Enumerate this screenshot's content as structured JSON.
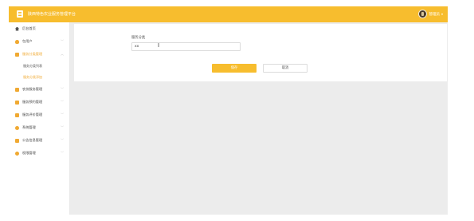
{
  "header": {
    "title": "陕西特色农业服务管理平台",
    "user_name": "管理员",
    "caret": "▾"
  },
  "sidebar": {
    "items": [
      {
        "label": "后台首页",
        "icon": "home-icon"
      },
      {
        "label": "包用户",
        "icon": "user-icon"
      },
      {
        "label": "服务分类管理",
        "icon": "grid-icon",
        "open": true,
        "children": [
          {
            "label": "服务分类列表",
            "active": false
          },
          {
            "label": "服务分类添加",
            "active": true
          }
        ]
      },
      {
        "label": "农技服务管理",
        "icon": "grid-icon"
      },
      {
        "label": "服务预约管理",
        "icon": "grid-icon"
      },
      {
        "label": "服务评价管理",
        "icon": "grid-icon"
      },
      {
        "label": "系统管理",
        "icon": "gear-icon"
      },
      {
        "label": "公告信息管理",
        "icon": "note-icon"
      },
      {
        "label": "权限管理",
        "icon": "gear-icon"
      }
    ],
    "chevron_down": "﹀",
    "chevron_up": "︿"
  },
  "form": {
    "field_label": "服务分类",
    "field_value": "xx",
    "save_label": "保存",
    "cancel_label": "取消"
  },
  "colors": {
    "brand": "#f7bd2e",
    "accent": "#f0a932"
  }
}
